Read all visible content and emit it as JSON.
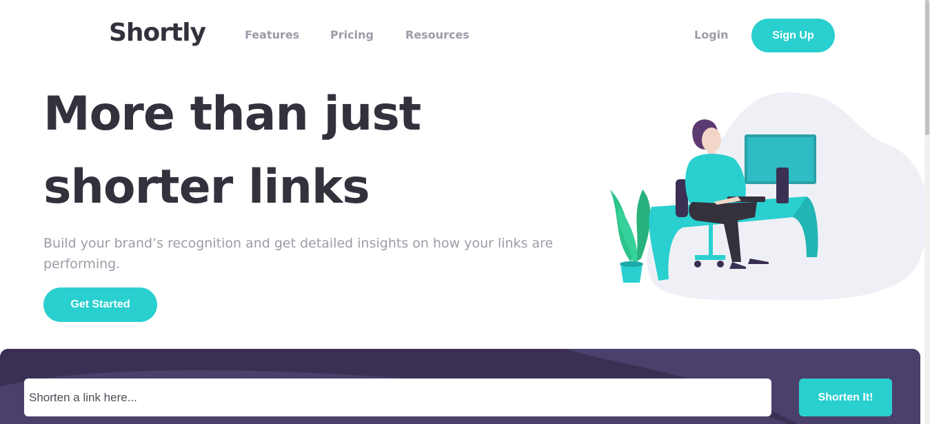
{
  "header": {
    "logo": "Shortly",
    "nav": [
      {
        "label": "Features"
      },
      {
        "label": "Pricing"
      },
      {
        "label": "Resources"
      }
    ],
    "login_label": "Login",
    "signup_label": "Sign Up"
  },
  "hero": {
    "title": "More than just shorter links",
    "subtitle": "Build your brand’s recognition and get detailed insights on how your links are performing.",
    "cta_label": "Get Started"
  },
  "shorten": {
    "placeholder": "Shorten a link here...",
    "button_label": "Shorten It!"
  },
  "colors": {
    "accent": "#2acfcf",
    "dark_violet": "#3b3054",
    "heading": "#34313d",
    "gray_text": "#9e9aa7"
  }
}
